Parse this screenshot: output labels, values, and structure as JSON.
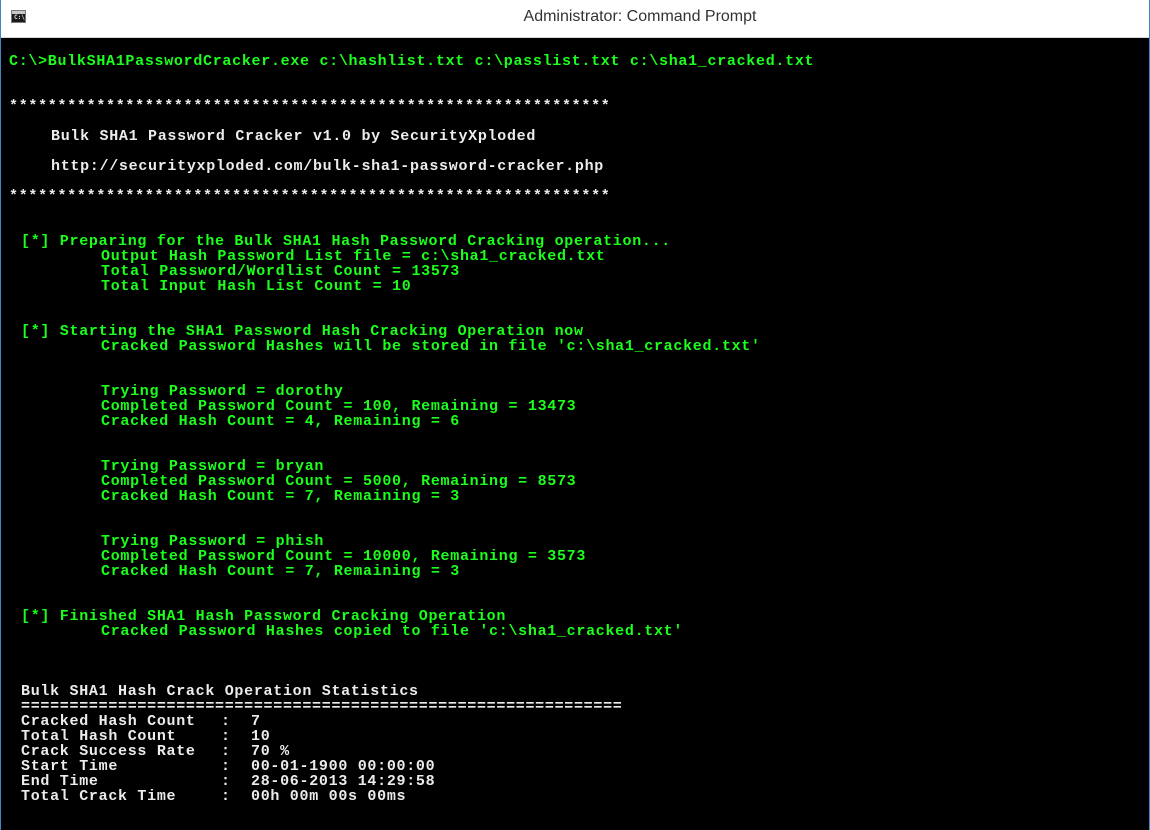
{
  "window": {
    "title": "Administrator: Command Prompt",
    "icon": "cmd-icon",
    "icon_glyph": "C:\\."
  },
  "command": "C:\\>BulkSHA1PasswordCracker.exe c:\\hashlist.txt c:\\passlist.txt c:\\sha1_cracked.txt",
  "banner": {
    "stars_top": "**************************************************************",
    "title": "Bulk SHA1 Password Cracker v1.0 by SecurityXploded",
    "url": "http://securityxploded.com/bulk-sha1-password-cracker.php",
    "stars_bottom": "**************************************************************"
  },
  "prepare": {
    "header": "[*] Preparing for the Bulk SHA1 Hash Password Cracking operation...",
    "output_file": "Output Hash Password List file = c:\\sha1_cracked.txt",
    "wordlist_count": "Total Password/Wordlist Count = 13573",
    "hash_count": "Total Input Hash List Count = 10"
  },
  "start": {
    "header": "[*] Starting the SHA1 Password Hash Cracking Operation now",
    "note": "Cracked Password Hashes will be stored in file 'c:\\sha1_cracked.txt'"
  },
  "progress": [
    {
      "trying": "Trying Password = dorothy",
      "completed": "Completed Password Count = 100, Remaining = 13473",
      "cracked": "Cracked Hash Count = 4, Remaining = 6"
    },
    {
      "trying": "Trying Password = bryan",
      "completed": "Completed Password Count = 5000, Remaining = 8573",
      "cracked": "Cracked Hash Count = 7, Remaining = 3"
    },
    {
      "trying": "Trying Password = phish",
      "completed": "Completed Password Count = 10000, Remaining = 3573",
      "cracked": "Cracked Hash Count = 7, Remaining = 3"
    }
  ],
  "finish": {
    "header": "[*] Finished SHA1 Hash Password Cracking Operation",
    "note": "Cracked Password Hashes copied to file 'c:\\sha1_cracked.txt'"
  },
  "stats": {
    "title": "Bulk SHA1 Hash Crack Operation Statistics",
    "divider": "==============================================================",
    "separator": ":",
    "rows": [
      {
        "key": "Cracked Hash Count",
        "value": "7"
      },
      {
        "key": "Total Hash Count",
        "value": "10"
      },
      {
        "key": "Crack Success Rate",
        "value": "70 %"
      },
      {
        "key": "Start Time",
        "value": "00-01-1900 00:00:00"
      },
      {
        "key": "End Time",
        "value": "28-06-2013 14:29:58"
      },
      {
        "key": "Total Crack Time",
        "value": "00h 00m 00s 00ms"
      }
    ]
  },
  "colors": {
    "green_text": "#1cff1c",
    "white_text": "#ececec",
    "background": "#000000"
  }
}
